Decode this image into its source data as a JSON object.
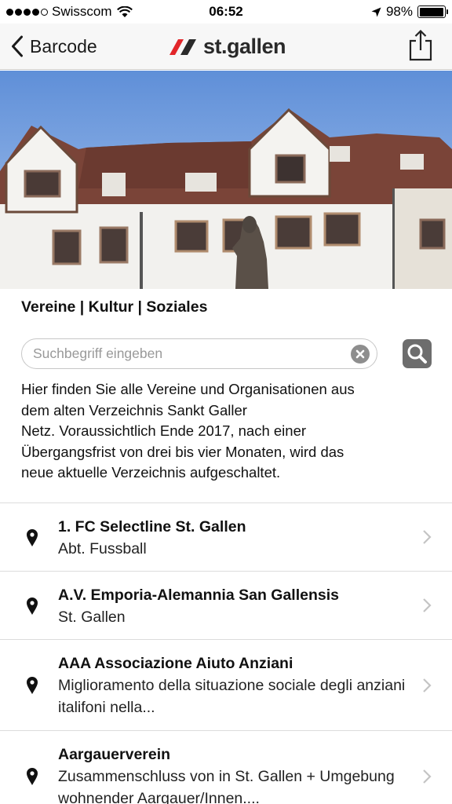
{
  "status_bar": {
    "carrier": "Swisscom",
    "time": "06:52",
    "battery": "98%",
    "battery_level": 0.98
  },
  "nav": {
    "back_label": "Barcode",
    "logo_text": "st.gallen",
    "logo_color": "#e2262a",
    "share_icon": "share-icon"
  },
  "categories": "Vereine | Kultur | Soziales",
  "search": {
    "placeholder": "Suchbegriff eingeben",
    "value": ""
  },
  "intro": "Hier finden Sie alle Vereine und Organisationen aus\ndem alten Verzeichnis Sankt Galler\nNetz. Voraussichtlich Ende 2017, nach einer\nÜbergangsfrist von drei bis vier Monaten, wird das\nneue aktuelle Verzeichnis aufgeschaltet.",
  "items": [
    {
      "title": "1. FC Selectline St. Gallen",
      "subtitle": "Abt. Fussball",
      "icon": "location-pin-icon"
    },
    {
      "title": "A.V. Emporia-Alemannia San Gallensis",
      "subtitle": "St. Gallen",
      "icon": "location-pin-icon"
    },
    {
      "title": "AAA Associazione Aiuto Anziani",
      "subtitle": "Miglioramento della situazione sociale degli anziani italifoni nella...",
      "icon": "location-pin-icon"
    },
    {
      "title": "Aargauerverein",
      "subtitle": "Zusammenschluss von in St. Gallen + Umgebung wohnender Aargauer/Innen....",
      "icon": "location-pin-icon"
    }
  ]
}
